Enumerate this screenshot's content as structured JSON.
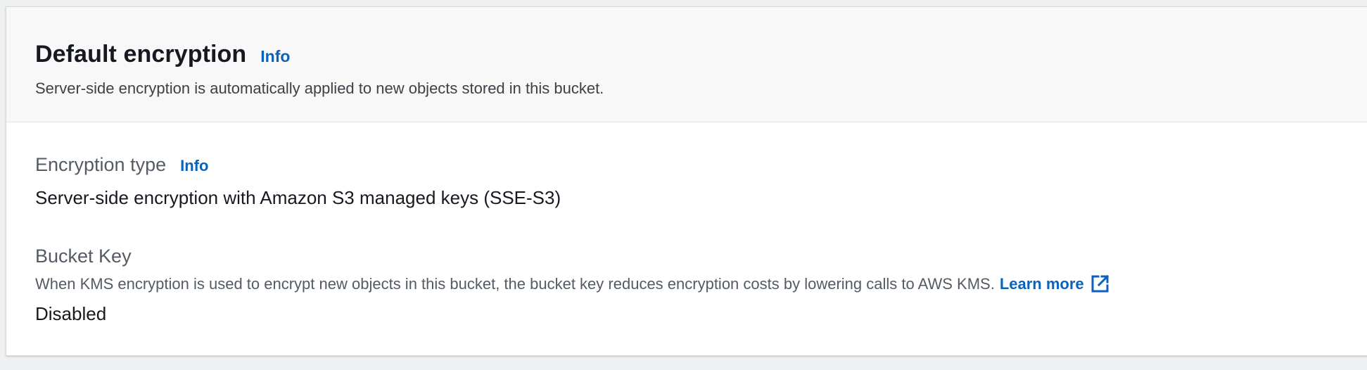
{
  "section": {
    "title": "Default encryption",
    "info_label": "Info",
    "description": "Server-side encryption is automatically applied to new objects stored in this bucket."
  },
  "encryption_type": {
    "label": "Encryption type",
    "info_label": "Info",
    "value": "Server-side encryption with Amazon S3 managed keys (SSE-S3)"
  },
  "bucket_key": {
    "label": "Bucket Key",
    "help_text": "When KMS encryption is used to encrypt new objects in this bucket, the bucket key reduces encryption costs by lowering calls to AWS KMS.",
    "learn_more_label": "Learn more",
    "learn_more_icon": "external-link-icon",
    "value": "Disabled"
  },
  "colors": {
    "link": "#0b62b9",
    "header_background": "#f8f8f8",
    "page_background": "#eef0f1",
    "text_primary": "#16191f",
    "text_secondary": "#545b64"
  }
}
